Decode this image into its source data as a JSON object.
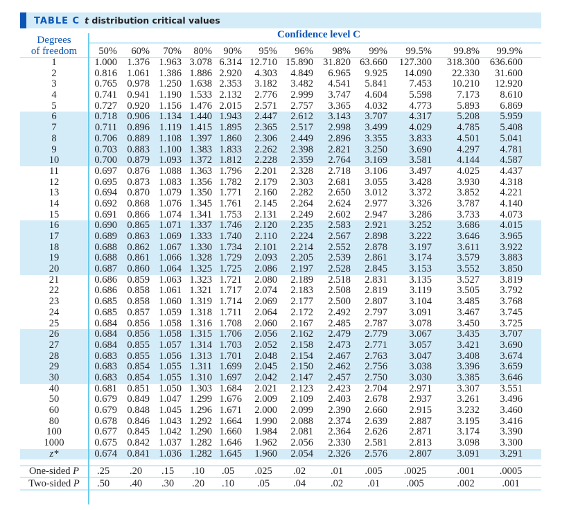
{
  "title": {
    "label": "TABLE C",
    "desc_italic": "t",
    "desc_rest": " distribution critical values"
  },
  "headers": {
    "df_line1": "Degrees",
    "df_line2": "of freedom",
    "confidence": "Confidence level C",
    "levels": [
      "50%",
      "60%",
      "70%",
      "80%",
      "90%",
      "95%",
      "96%",
      "98%",
      "99%",
      "99.5%",
      "99.8%",
      "99.9%"
    ]
  },
  "colors": {
    "accent_blue": "#0b56b5",
    "shade": "#d4ecf8",
    "rule": "#6ccbec"
  },
  "rows": [
    {
      "df": "1",
      "values": [
        "1.000",
        "1.376",
        "1.963",
        "3.078",
        "6.314",
        "12.710",
        "15.890",
        "31.820",
        "63.660",
        "127.300",
        "318.300",
        "636.600"
      ]
    },
    {
      "df": "2",
      "values": [
        "0.816",
        "1.061",
        "1.386",
        "1.886",
        "2.920",
        "4.303",
        "4.849",
        "6.965",
        "9.925",
        "14.090",
        "22.330",
        "31.600"
      ]
    },
    {
      "df": "3",
      "values": [
        "0.765",
        "0.978",
        "1.250",
        "1.638",
        "2.353",
        "3.182",
        "3.482",
        "4.541",
        "5.841",
        "7.453",
        "10.210",
        "12.920"
      ]
    },
    {
      "df": "4",
      "values": [
        "0.741",
        "0.941",
        "1.190",
        "1.533",
        "2.132",
        "2.776",
        "2.999",
        "3.747",
        "4.604",
        "5.598",
        "7.173",
        "8.610"
      ]
    },
    {
      "df": "5",
      "values": [
        "0.727",
        "0.920",
        "1.156",
        "1.476",
        "2.015",
        "2.571",
        "2.757",
        "3.365",
        "4.032",
        "4.773",
        "5.893",
        "6.869"
      ]
    },
    {
      "df": "6",
      "values": [
        "0.718",
        "0.906",
        "1.134",
        "1.440",
        "1.943",
        "2.447",
        "2.612",
        "3.143",
        "3.707",
        "4.317",
        "5.208",
        "5.959"
      ]
    },
    {
      "df": "7",
      "values": [
        "0.711",
        "0.896",
        "1.119",
        "1.415",
        "1.895",
        "2.365",
        "2.517",
        "2.998",
        "3.499",
        "4.029",
        "4.785",
        "5.408"
      ]
    },
    {
      "df": "8",
      "values": [
        "0.706",
        "0.889",
        "1.108",
        "1.397",
        "1.860",
        "2.306",
        "2.449",
        "2.896",
        "3.355",
        "3.833",
        "4.501",
        "5.041"
      ]
    },
    {
      "df": "9",
      "values": [
        "0.703",
        "0.883",
        "1.100",
        "1.383",
        "1.833",
        "2.262",
        "2.398",
        "2.821",
        "3.250",
        "3.690",
        "4.297",
        "4.781"
      ]
    },
    {
      "df": "10",
      "values": [
        "0.700",
        "0.879",
        "1.093",
        "1.372",
        "1.812",
        "2.228",
        "2.359",
        "2.764",
        "3.169",
        "3.581",
        "4.144",
        "4.587"
      ]
    },
    {
      "df": "11",
      "values": [
        "0.697",
        "0.876",
        "1.088",
        "1.363",
        "1.796",
        "2.201",
        "2.328",
        "2.718",
        "3.106",
        "3.497",
        "4.025",
        "4.437"
      ]
    },
    {
      "df": "12",
      "values": [
        "0.695",
        "0.873",
        "1.083",
        "1.356",
        "1.782",
        "2.179",
        "2.303",
        "2.681",
        "3.055",
        "3.428",
        "3.930",
        "4.318"
      ]
    },
    {
      "df": "13",
      "values": [
        "0.694",
        "0.870",
        "1.079",
        "1.350",
        "1.771",
        "2.160",
        "2.282",
        "2.650",
        "3.012",
        "3.372",
        "3.852",
        "4.221"
      ]
    },
    {
      "df": "14",
      "values": [
        "0.692",
        "0.868",
        "1.076",
        "1.345",
        "1.761",
        "2.145",
        "2.264",
        "2.624",
        "2.977",
        "3.326",
        "3.787",
        "4.140"
      ]
    },
    {
      "df": "15",
      "values": [
        "0.691",
        "0.866",
        "1.074",
        "1.341",
        "1.753",
        "2.131",
        "2.249",
        "2.602",
        "2.947",
        "3.286",
        "3.733",
        "4.073"
      ]
    },
    {
      "df": "16",
      "values": [
        "0.690",
        "0.865",
        "1.071",
        "1.337",
        "1.746",
        "2.120",
        "2.235",
        "2.583",
        "2.921",
        "3.252",
        "3.686",
        "4.015"
      ]
    },
    {
      "df": "17",
      "values": [
        "0.689",
        "0.863",
        "1.069",
        "1.333",
        "1.740",
        "2.110",
        "2.224",
        "2.567",
        "2.898",
        "3.222",
        "3.646",
        "3.965"
      ]
    },
    {
      "df": "18",
      "values": [
        "0.688",
        "0.862",
        "1.067",
        "1.330",
        "1.734",
        "2.101",
        "2.214",
        "2.552",
        "2.878",
        "3.197",
        "3.611",
        "3.922"
      ]
    },
    {
      "df": "19",
      "values": [
        "0.688",
        "0.861",
        "1.066",
        "1.328",
        "1.729",
        "2.093",
        "2.205",
        "2.539",
        "2.861",
        "3.174",
        "3.579",
        "3.883"
      ]
    },
    {
      "df": "20",
      "values": [
        "0.687",
        "0.860",
        "1.064",
        "1.325",
        "1.725",
        "2.086",
        "2.197",
        "2.528",
        "2.845",
        "3.153",
        "3.552",
        "3.850"
      ]
    },
    {
      "df": "21",
      "values": [
        "0.686",
        "0.859",
        "1.063",
        "1.323",
        "1.721",
        "2.080",
        "2.189",
        "2.518",
        "2.831",
        "3.135",
        "3.527",
        "3.819"
      ]
    },
    {
      "df": "22",
      "values": [
        "0.686",
        "0.858",
        "1.061",
        "1.321",
        "1.717",
        "2.074",
        "2.183",
        "2.508",
        "2.819",
        "3.119",
        "3.505",
        "3.792"
      ]
    },
    {
      "df": "23",
      "values": [
        "0.685",
        "0.858",
        "1.060",
        "1.319",
        "1.714",
        "2.069",
        "2.177",
        "2.500",
        "2.807",
        "3.104",
        "3.485",
        "3.768"
      ]
    },
    {
      "df": "24",
      "values": [
        "0.685",
        "0.857",
        "1.059",
        "1.318",
        "1.711",
        "2.064",
        "2.172",
        "2.492",
        "2.797",
        "3.091",
        "3.467",
        "3.745"
      ]
    },
    {
      "df": "25",
      "values": [
        "0.684",
        "0.856",
        "1.058",
        "1.316",
        "1.708",
        "2.060",
        "2.167",
        "2.485",
        "2.787",
        "3.078",
        "3.450",
        "3.725"
      ]
    },
    {
      "df": "26",
      "values": [
        "0.684",
        "0.856",
        "1.058",
        "1.315",
        "1.706",
        "2.056",
        "2.162",
        "2.479",
        "2.779",
        "3.067",
        "3.435",
        "3.707"
      ]
    },
    {
      "df": "27",
      "values": [
        "0.684",
        "0.855",
        "1.057",
        "1.314",
        "1.703",
        "2.052",
        "2.158",
        "2.473",
        "2.771",
        "3.057",
        "3.421",
        "3.690"
      ]
    },
    {
      "df": "28",
      "values": [
        "0.683",
        "0.855",
        "1.056",
        "1.313",
        "1.701",
        "2.048",
        "2.154",
        "2.467",
        "2.763",
        "3.047",
        "3.408",
        "3.674"
      ]
    },
    {
      "df": "29",
      "values": [
        "0.683",
        "0.854",
        "1.055",
        "1.311",
        "1.699",
        "2.045",
        "2.150",
        "2.462",
        "2.756",
        "3.038",
        "3.396",
        "3.659"
      ]
    },
    {
      "df": "30",
      "values": [
        "0.683",
        "0.854",
        "1.055",
        "1.310",
        "1.697",
        "2.042",
        "2.147",
        "2.457",
        "2.750",
        "3.030",
        "3.385",
        "3.646"
      ]
    },
    {
      "df": "40",
      "values": [
        "0.681",
        "0.851",
        "1.050",
        "1.303",
        "1.684",
        "2.021",
        "2.123",
        "2.423",
        "2.704",
        "2.971",
        "3.307",
        "3.551"
      ]
    },
    {
      "df": "50",
      "values": [
        "0.679",
        "0.849",
        "1.047",
        "1.299",
        "1.676",
        "2.009",
        "2.109",
        "2.403",
        "2.678",
        "2.937",
        "3.261",
        "3.496"
      ]
    },
    {
      "df": "60",
      "values": [
        "0.679",
        "0.848",
        "1.045",
        "1.296",
        "1.671",
        "2.000",
        "2.099",
        "2.390",
        "2.660",
        "2.915",
        "3.232",
        "3.460"
      ]
    },
    {
      "df": "80",
      "values": [
        "0.678",
        "0.846",
        "1.043",
        "1.292",
        "1.664",
        "1.990",
        "2.088",
        "2.374",
        "2.639",
        "2.887",
        "3.195",
        "3.416"
      ]
    },
    {
      "df": "100",
      "values": [
        "0.677",
        "0.845",
        "1.042",
        "1.290",
        "1.660",
        "1.984",
        "2.081",
        "2.364",
        "2.626",
        "2.871",
        "3.174",
        "3.390"
      ]
    },
    {
      "df": "1000",
      "values": [
        "0.675",
        "0.842",
        "1.037",
        "1.282",
        "1.646",
        "1.962",
        "2.056",
        "2.330",
        "2.581",
        "2.813",
        "3.098",
        "3.300"
      ]
    },
    {
      "df": "z*",
      "values": [
        "0.674",
        "0.841",
        "1.036",
        "1.282",
        "1.645",
        "1.960",
        "2.054",
        "2.326",
        "2.576",
        "2.807",
        "3.091",
        "3.291"
      ]
    }
  ],
  "shaded_row_groups": [
    "6-10",
    "16-20",
    "26-30",
    "z*"
  ],
  "p_rows": [
    {
      "label": "One-sided P",
      "values": [
        ".25",
        ".20",
        ".15",
        ".10",
        ".05",
        ".025",
        ".02",
        ".01",
        ".005",
        ".0025",
        ".001",
        ".0005"
      ]
    },
    {
      "label": "Two-sided P",
      "values": [
        ".50",
        ".40",
        ".30",
        ".20",
        ".10",
        ".05",
        ".04",
        ".02",
        ".01",
        ".005",
        ".002",
        ".001"
      ]
    }
  ]
}
